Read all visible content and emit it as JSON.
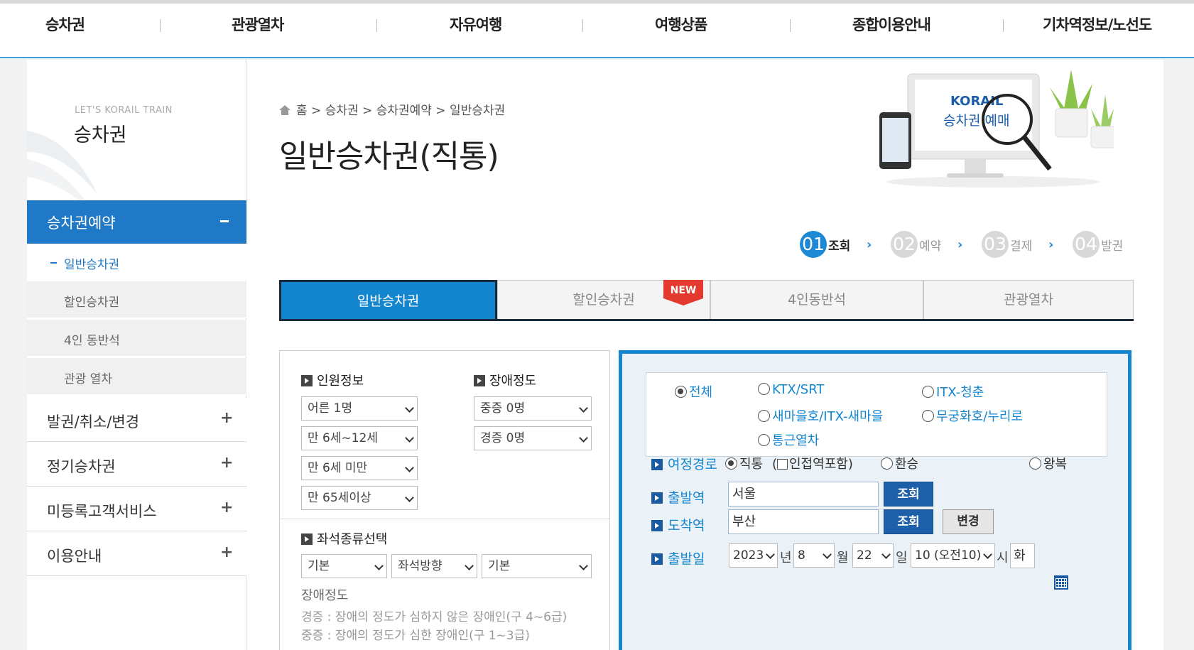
{
  "topnav": {
    "items": [
      "승차권",
      "관광열차",
      "자유여행",
      "여행상품",
      "종합이용안내",
      "기차역정보/노선도"
    ]
  },
  "lnb": {
    "subtitle": "LET'S KORAIL TRAIN",
    "title": "승차권",
    "active": "승차권예약",
    "subitems": [
      "일반승차권",
      "할인승차권",
      "4인 동반석",
      "관광 열차"
    ],
    "main_items": [
      "발권/취소/변경",
      "정기승차권",
      "미등록고객서비스",
      "이용안내"
    ]
  },
  "breadcrumb": [
    "홈",
    "승차권",
    "승차권예약",
    "일반승차권"
  ],
  "page_title": "일반승차권(직통)",
  "hero": {
    "brand": "KORAIL",
    "caption": "승차권 예매"
  },
  "steps": [
    {
      "num": "01",
      "label": "조회"
    },
    {
      "num": "02",
      "label": "예약"
    },
    {
      "num": "03",
      "label": "결제"
    },
    {
      "num": "04",
      "label": "발권"
    }
  ],
  "tabs": [
    "일반승차권",
    "할인승차권",
    "4인동반석",
    "관광열차"
  ],
  "new_badge": "NEW",
  "passenger": {
    "heading": "인원정보",
    "adult": "어른 1명",
    "child": "만 6세~12세",
    "infant": "만 6세 미만",
    "senior": "만 65세이상"
  },
  "disability": {
    "heading": "장애정도",
    "severe": "중증 0명",
    "mild": "경증 0명"
  },
  "seat": {
    "heading": "좌석종류선택",
    "type": "기본",
    "direction": "좌석방향",
    "option": "기본"
  },
  "notes": {
    "heading": "장애정도",
    "mild": "경증 : 장애의 정도가 심하지 않은 장애인(구 4~6급)",
    "severe": "중증 : 장애의 정도가 심한 장애인(구 1~3급)"
  },
  "train_types": {
    "all": "전체",
    "ktx": "KTX/SRT",
    "itx": "ITX-청춘",
    "saemaeul": "새마을호/ITX-새마을",
    "mugunghwa": "무궁화호/누리로",
    "commuter": "통근열차"
  },
  "route": {
    "label": "여정경로",
    "direct": "직통",
    "adjacent": "인접역포함",
    "transfer": "환승",
    "round": "왕복"
  },
  "departure": {
    "label": "출발역",
    "value": "서울",
    "search": "조회"
  },
  "arrival": {
    "label": "도착역",
    "value": "부산",
    "search": "조회",
    "swap": "변경"
  },
  "date": {
    "label": "출발일",
    "year": "2023",
    "year_unit": "년",
    "month": "8",
    "month_unit": "월",
    "day": "22",
    "day_unit": "일",
    "hour": "10 (오전10)",
    "hour_unit": "시",
    "weekday": "화"
  }
}
